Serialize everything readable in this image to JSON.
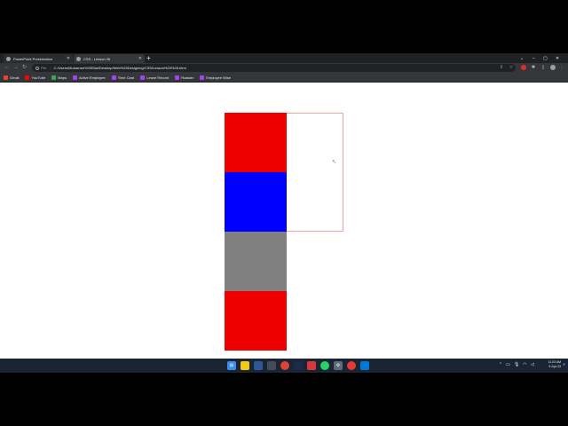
{
  "browser": {
    "tabs": [
      {
        "title": "PowerPoint Presentation",
        "active": false
      },
      {
        "title": "CSS - Lesson 26",
        "active": true
      }
    ],
    "new_tab_symbol": "+",
    "address": {
      "scheme": "File",
      "url": "C:/Users/Mukarram%20Bilal/Desktop/Web%20Designing/CSS/Lesson%20%26.html"
    },
    "bookmarks": [
      {
        "label": "Gmail",
        "icon": "gmail-icon",
        "color": "#ea4335"
      },
      {
        "label": "YouTube",
        "icon": "youtube-icon",
        "color": "#ff0000"
      },
      {
        "label": "Maps",
        "icon": "maps-icon",
        "color": "#34a853"
      },
      {
        "label": "Active Employee",
        "icon": "employee-icon",
        "color": "#a142f4"
      },
      {
        "label": "Time Card",
        "icon": "timecard-icon",
        "color": "#a142f4"
      },
      {
        "label": "Leave Record",
        "icon": "leave-icon",
        "color": "#a142f4"
      },
      {
        "label": "Roaster",
        "icon": "roaster-icon",
        "color": "#a142f4"
      },
      {
        "label": "Employee Wise",
        "icon": "employee-wise-icon",
        "color": "#a142f4"
      }
    ]
  },
  "page": {
    "blocks": [
      {
        "name": "red-box-1",
        "color": "#ee0000"
      },
      {
        "name": "blue-box",
        "color": "#0000ff"
      },
      {
        "name": "gray-box",
        "color": "#808080"
      },
      {
        "name": "red-box-2",
        "color": "#ee0000"
      }
    ],
    "container_outline_color": "#f3a3a3"
  },
  "taskbar": {
    "apps": [
      {
        "name": "start-icon",
        "color": "#3b8eea"
      },
      {
        "name": "file-explorer-icon",
        "color": "#f2c811"
      },
      {
        "name": "calendar-icon",
        "color": "#2b5797"
      },
      {
        "name": "store-icon",
        "color": "#444c5c"
      },
      {
        "name": "chrome-icon",
        "color": "#db4437"
      },
      {
        "name": "photoshop-icon",
        "color": "#1c2b4a"
      },
      {
        "name": "adobe-icon",
        "color": "#d7373f"
      },
      {
        "name": "whatsapp-icon",
        "color": "#25d366"
      },
      {
        "name": "settings-icon",
        "color": "#5f6b7a"
      },
      {
        "name": "screen-recorder-icon",
        "color": "#e53935"
      },
      {
        "name": "vscode-icon",
        "color": "#0078d4"
      }
    ],
    "clock": {
      "time": "11:23 AM",
      "date": "9-Apr-23"
    }
  }
}
